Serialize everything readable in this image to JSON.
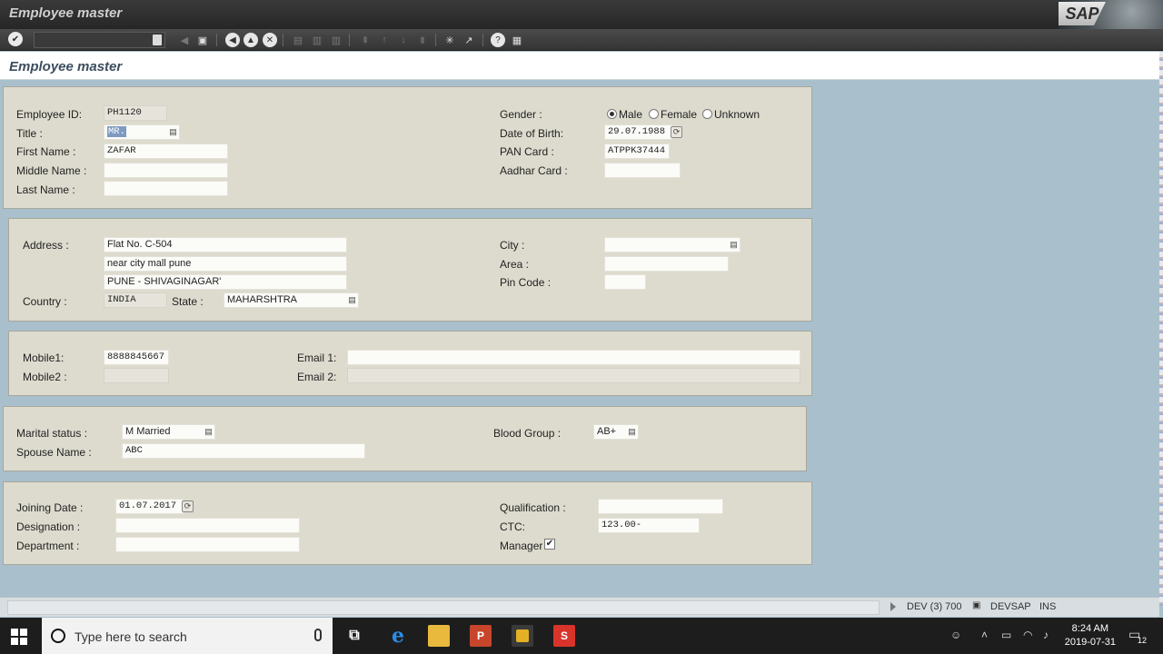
{
  "window": {
    "title": "Employee master",
    "logo": "SAP"
  },
  "toolbar": {
    "icons": [
      "enter-icon",
      "back-icon",
      "save-icon",
      "back-arrow-icon",
      "exit-icon",
      "cancel-icon",
      "print-icon",
      "find-icon",
      "find-next-icon",
      "first-page-icon",
      "prev-page-icon",
      "next-page-icon",
      "last-page-icon",
      "new-session-icon",
      "shortcut-icon",
      "help-icon",
      "layout-icon"
    ]
  },
  "screen_title": "Employee master",
  "personal": {
    "employee_id_label": "Employee ID:",
    "employee_id": "PH1120",
    "title_label": "Title :",
    "title": "MR.",
    "first_name_label": "First Name :",
    "first_name": "ZAFAR",
    "middle_name_label": "Middle Name :",
    "middle_name": "",
    "last_name_label": "Last Name :",
    "last_name": "",
    "gender_label": "Gender :",
    "gender_options": [
      "Male",
      "Female",
      "Unknown"
    ],
    "gender_selected": "Male",
    "dob_label": "Date of Birth:",
    "dob": "29.07.1988",
    "pan_label": "PAN Card :",
    "pan": "ATPPK37444",
    "aadhar_label": "Aadhar Card :",
    "aadhar": ""
  },
  "address": {
    "address_label": "Address :",
    "line1": "Flat No. C-504",
    "line2": "near city mall pune",
    "line3": "PUNE - SHIVAGINAGAR'",
    "country_label": "Country :",
    "country": "INDIA",
    "state_label": "State :",
    "state": "MAHARSHTRA",
    "city_label": "City :",
    "city": "",
    "area_label": "Area :",
    "area": "",
    "pin_label": "Pin Code :",
    "pin": ""
  },
  "contact": {
    "mobile1_label": "Mobile1:",
    "mobile1": "8888845667",
    "mobile2_label": "Mobile2 :",
    "mobile2": "",
    "email1_label": "Email 1:",
    "email1": "",
    "email2_label": "Email 2:",
    "email2": ""
  },
  "family": {
    "marital_label": "Marital status :",
    "marital": "M Married",
    "spouse_label": "Spouse Name :",
    "spouse": "ABC",
    "blood_label": "Blood Group :",
    "blood": "AB+"
  },
  "job": {
    "joining_label": "Joining Date :",
    "joining": "01.07.2017",
    "designation_label": "Designation :",
    "designation": "",
    "department_label": "Department :",
    "department": "",
    "qualification_label": "Qualification :",
    "qualification": "",
    "ctc_label": "CTC:",
    "ctc": "123.00-",
    "manager_label": "Manager",
    "manager_checked": true
  },
  "statusbar": {
    "system": "DEV (3) 700",
    "server": "DEVSAP",
    "mode": "INS"
  },
  "taskbar": {
    "search_placeholder": "Type here to search",
    "time": "8:24 AM",
    "date": "2019-07-31",
    "notifications": "12"
  },
  "colors": {
    "box": "#dddbce",
    "background": "#a9bfcc",
    "selection": "#7d9ac1"
  }
}
